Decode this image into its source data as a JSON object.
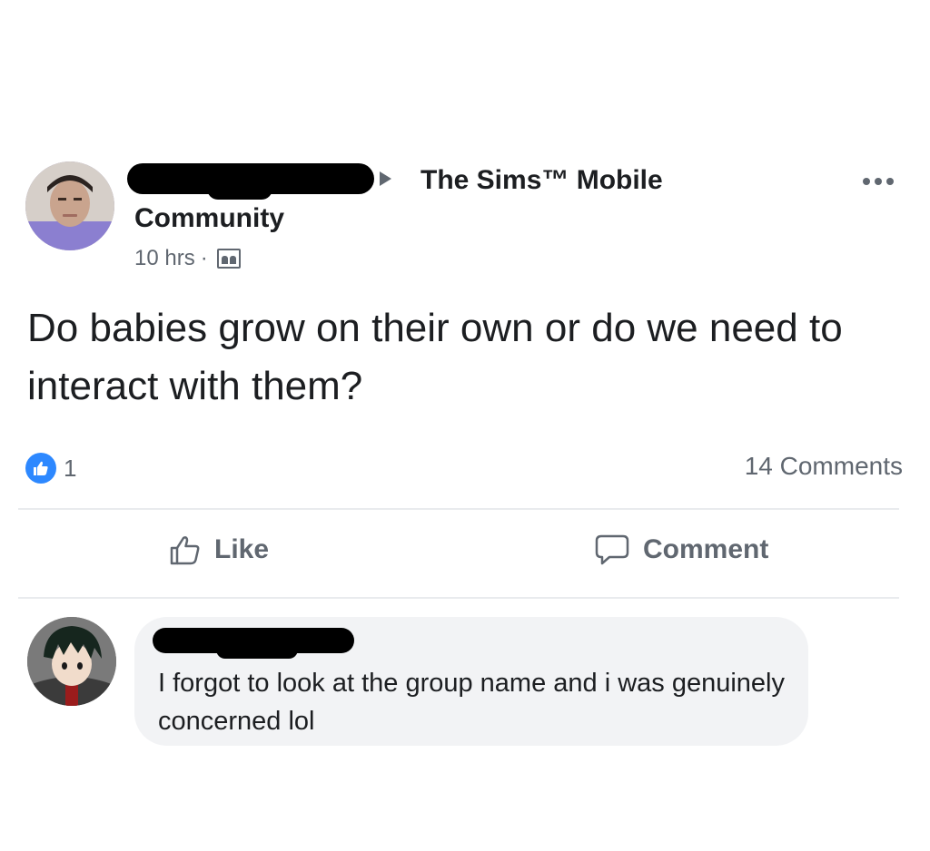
{
  "post": {
    "arrow_icon": "right-triangle-icon",
    "group_name": "The Sims™ Mobile",
    "group_name_suffix": "Community",
    "time": "10 hrs",
    "separator": "·",
    "audience_icon": "group-icon",
    "more_icon": "more-dots-icon",
    "text": "Do babies grow on their own or do we need to interact with them?",
    "reaction_icon": "thumbs-up-icon",
    "reaction_count": "1",
    "comment_count": "14 Comments",
    "actions": {
      "like": "Like",
      "comment": "Comment"
    }
  },
  "comment": {
    "text": "I forgot to look at the group name and i was genuinely concerned lol"
  },
  "colors": {
    "like_blue": "#2d88ff",
    "secondary_text": "#606770",
    "bubble_bg": "#f2f3f5"
  }
}
